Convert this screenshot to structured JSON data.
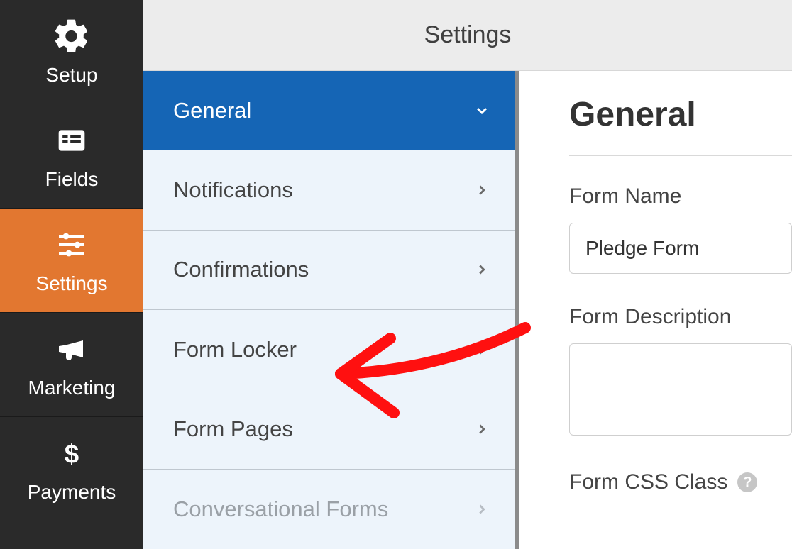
{
  "sidebar": {
    "items": [
      {
        "label": "Setup"
      },
      {
        "label": "Fields"
      },
      {
        "label": "Settings"
      },
      {
        "label": "Marketing"
      },
      {
        "label": "Payments"
      }
    ]
  },
  "topbar": {
    "title": "Settings"
  },
  "panel": {
    "items": [
      {
        "label": "General"
      },
      {
        "label": "Notifications"
      },
      {
        "label": "Confirmations"
      },
      {
        "label": "Form Locker"
      },
      {
        "label": "Form Pages"
      },
      {
        "label": "Conversational Forms"
      }
    ]
  },
  "content": {
    "heading": "General",
    "form_name_label": "Form Name",
    "form_name_value": "Pledge Form",
    "form_desc_label": "Form Description",
    "form_desc_value": "",
    "form_css_label": "Form CSS Class"
  }
}
